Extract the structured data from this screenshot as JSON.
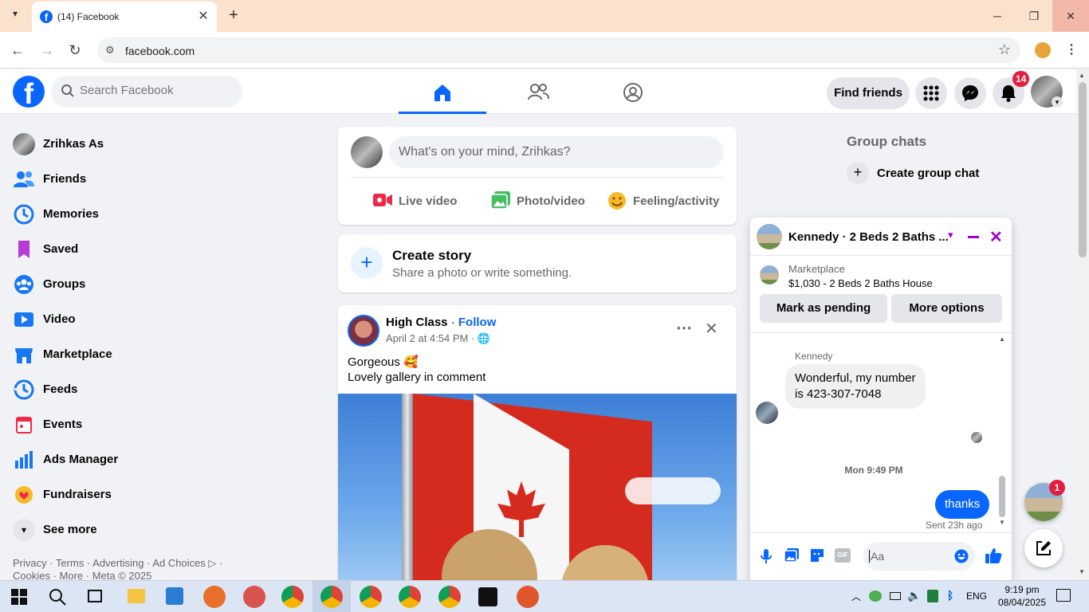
{
  "browser": {
    "tab_title": "(14) Facebook",
    "url": "facebook.com"
  },
  "header": {
    "search_placeholder": "Search Facebook",
    "find_friends": "Find friends",
    "notification_count": "14"
  },
  "sidebar": {
    "items": [
      {
        "label": "Zrihkas As",
        "icon": "profile-avatar"
      },
      {
        "label": "Friends",
        "icon": "friends-icon"
      },
      {
        "label": "Memories",
        "icon": "memories-icon"
      },
      {
        "label": "Saved",
        "icon": "saved-icon"
      },
      {
        "label": "Groups",
        "icon": "groups-icon"
      },
      {
        "label": "Video",
        "icon": "video-icon"
      },
      {
        "label": "Marketplace",
        "icon": "marketplace-icon"
      },
      {
        "label": "Feeds",
        "icon": "feeds-icon"
      },
      {
        "label": "Events",
        "icon": "events-icon"
      },
      {
        "label": "Ads Manager",
        "icon": "ads-manager-icon"
      },
      {
        "label": "Fundraisers",
        "icon": "fundraisers-icon"
      },
      {
        "label": "See more",
        "icon": "chevron-down-icon"
      }
    ],
    "footer_line1": "Privacy · Terms · Advertising · Ad Choices ▷ ·",
    "footer_line2": "Cookies · More · Meta © 2025"
  },
  "composer": {
    "placeholder": "What's on your mind, Zrihkas?",
    "live_video": "Live video",
    "photo_video": "Photo/video",
    "feeling_activity": "Feeling/activity"
  },
  "story": {
    "title": "Create story",
    "subtitle": "Share a photo or write something."
  },
  "post": {
    "author": "High Class",
    "follow": "Follow",
    "separator": " · ",
    "timestamp": "April 2 at 4:54 PM",
    "timestamp_suffix": " · ",
    "line1": "Gorgeous 🥰",
    "line2": "Lovely gallery in comment"
  },
  "group_chats": {
    "title": "Group chats",
    "create": "Create group chat"
  },
  "chat": {
    "title": "Kennedy · 2 Beds 2 Baths ...",
    "marketplace_label": "Marketplace",
    "listing": "$1,030 - 2 Beds 2 Baths House",
    "mark_pending": "Mark as pending",
    "more_options": "More options",
    "sender_name": "Kennedy",
    "incoming_message": "Wonderful, my number is 423-307-7048",
    "time_divider": "Mon 9:49 PM",
    "outgoing_message": "thanks",
    "sent_status": "Sent 23h ago",
    "input_placeholder": "Aa"
  },
  "floating": {
    "chat_badge": "1"
  },
  "taskbar": {
    "language": "ENG",
    "time": "9:19 pm",
    "date": "08/04/2025"
  },
  "colors": {
    "fb_blue": "#0866ff",
    "chat_accent": "#a100d8",
    "badge_red": "#e41e3f"
  }
}
